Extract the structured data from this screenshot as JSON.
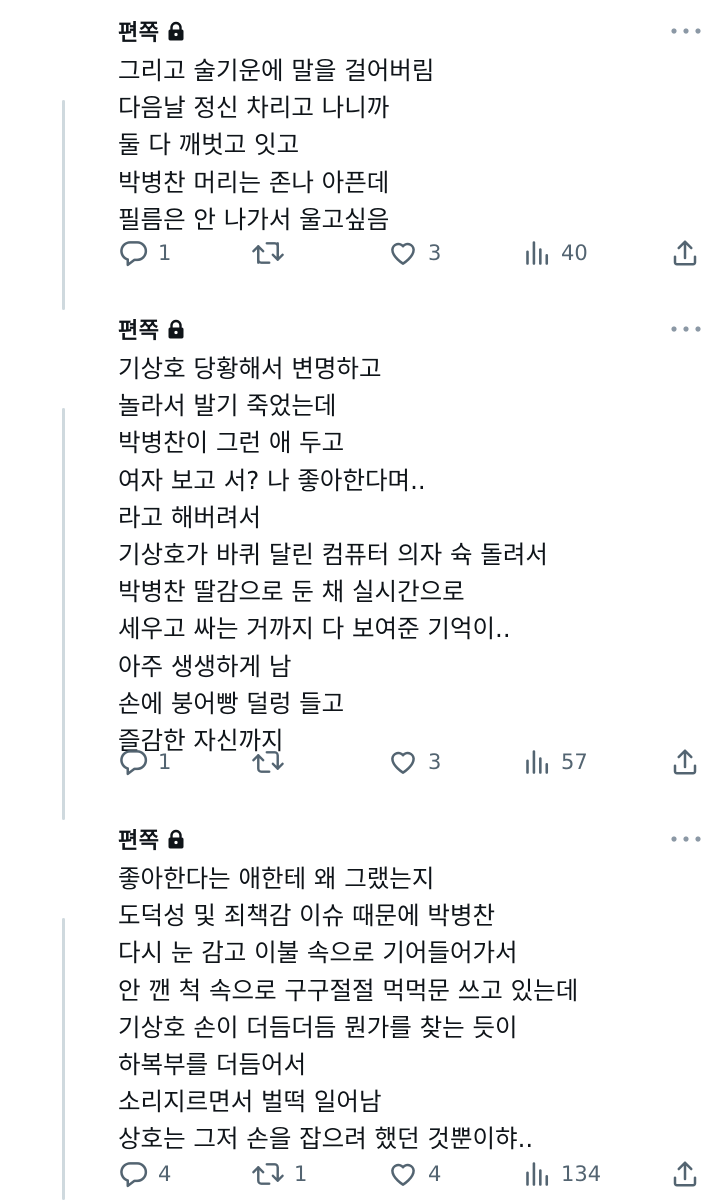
{
  "tweets": [
    {
      "author": "편쪽",
      "lines": [
        "그리고 술기운에 말을 걸어버림",
        "다음날 정신 차리고 나니까",
        "둘 다 깨벗고 잇고",
        "박병찬 머리는 존나 아픈데",
        "필름은 안 나가서 울고싶음"
      ],
      "replies": "1",
      "retweets": "",
      "likes": "3",
      "views": "40"
    },
    {
      "author": "편쪽",
      "lines": [
        "기상호 당황해서 변명하고",
        "놀라서 발기 죽었는데",
        "박병찬이 그런 애 두고",
        "여자 보고 서? 나 좋아한다며..",
        "라고 해버려서",
        "기상호가 바퀴 달린 컴퓨터 의자 슉 돌려서",
        "박병찬 딸감으로 둔 채 실시간으로",
        "세우고 싸는 거까지 다 보여준 기억이..",
        "아주 생생하게 남",
        "손에 붕어빵 덜렁 들고",
        "즐감한 자신까지"
      ],
      "replies": "1",
      "retweets": "",
      "likes": "3",
      "views": "57"
    },
    {
      "author": "편쪽",
      "lines": [
        "좋아한다는 애한테 왜 그랬는지",
        "도덕성 및 죄책감 이슈 때문에 박병찬",
        "다시 눈 감고 이불 속으로 기어들어가서",
        "안 깬 척 속으로 구구절절 먹먹문 쓰고 있는데",
        "기상호 손이 더듬더듬 뭔가를 찾는 듯이",
        "하복부를 더듬어서",
        "소리지르면서 벌떡 일어남",
        "상호는 그저 손을 잡으려 했던 것뿐이햐.."
      ],
      "replies": "4",
      "retweets": "1",
      "likes": "4",
      "views": "134"
    }
  ],
  "icons": {
    "lock": "lock-icon",
    "more": "more-horizontal-icon",
    "reply": "reply-bubble-icon",
    "retweet": "retweet-icon",
    "like": "heart-icon",
    "views": "views-bar-chart-icon",
    "share": "share-upload-icon"
  },
  "colors": {
    "text": "#0f1419",
    "secondary": "#536471",
    "thread_line": "#cfd9de",
    "background": "#ffffff"
  }
}
